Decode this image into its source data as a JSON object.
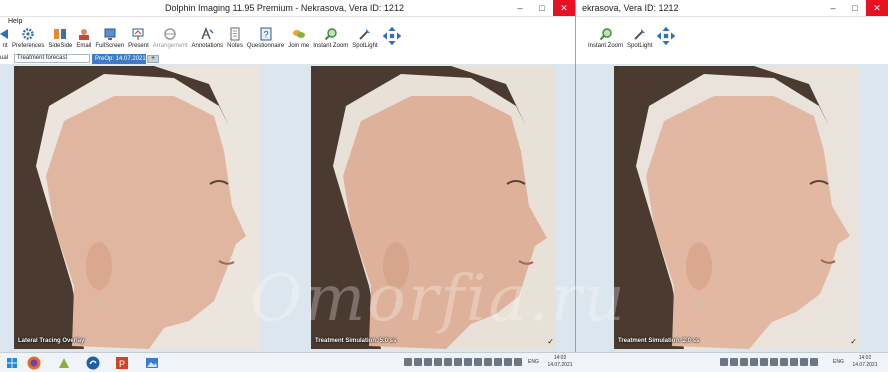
{
  "main_window": {
    "title": "Dolphin Imaging 11.95 Premium - Nekrasova, Vera  ID: 1212",
    "minimize": "–",
    "maximize": "□",
    "close": "✕"
  },
  "side_window": {
    "title": "ekrasova, Vera  ID: 1212",
    "minimize": "–",
    "maximize": "□",
    "close": "✕"
  },
  "menu": {
    "help": "Help"
  },
  "toolbar_main": [
    {
      "label": "nt",
      "icon": "arrow-icon"
    },
    {
      "label": "Preferences",
      "icon": "gear-icon"
    },
    {
      "label": "SideSide",
      "icon": "side-by-side-icon"
    },
    {
      "label": "Email",
      "icon": "email-icon"
    },
    {
      "label": "FullScreen",
      "icon": "fullscreen-icon"
    },
    {
      "label": "Present",
      "icon": "present-icon"
    },
    {
      "label": "Arrangement",
      "icon": "arrangement-icon",
      "disabled": true
    },
    {
      "label": "Annotations",
      "icon": "annotations-icon"
    },
    {
      "label": "Notes",
      "icon": "notes-icon"
    },
    {
      "label": "Questionnaire",
      "icon": "questionnaire-icon"
    },
    {
      "label": "Join me",
      "icon": "join-me-icon"
    },
    {
      "label": "Instant Zoom",
      "icon": "zoom-icon"
    },
    {
      "label": "SpotLight",
      "icon": "spotlight-icon"
    },
    {
      "label": "",
      "icon": "move-icon"
    }
  ],
  "toolbar_side": [
    {
      "label": "Instant Zoom",
      "icon": "zoom-icon"
    },
    {
      "label": "SpotLight",
      "icon": "spotlight-icon"
    },
    {
      "label": "",
      "icon": "move-icon"
    }
  ],
  "tabs": {
    "left_label": "ual",
    "select_value": "Treatment forecast",
    "active_tab": "PreOp: 14.07.2021",
    "add": "+"
  },
  "photos": [
    {
      "caption": "Lateral Tracing Overlay"
    },
    {
      "caption": "Treatment Simulation: 5.0 ss"
    },
    {
      "caption": "Treatment Simulation: 2.0 ss"
    }
  ],
  "watermark": "Omorfia.ru",
  "taskbar": {
    "tray_lang": "ENG",
    "time_1": "14:02",
    "date_1": "14.07.2021",
    "time_2": "14:02",
    "date_2": "14.07.2021"
  },
  "colors": {
    "accent": "#3a7cc8",
    "close": "#e81123",
    "content_bg": "#dce6ee"
  }
}
